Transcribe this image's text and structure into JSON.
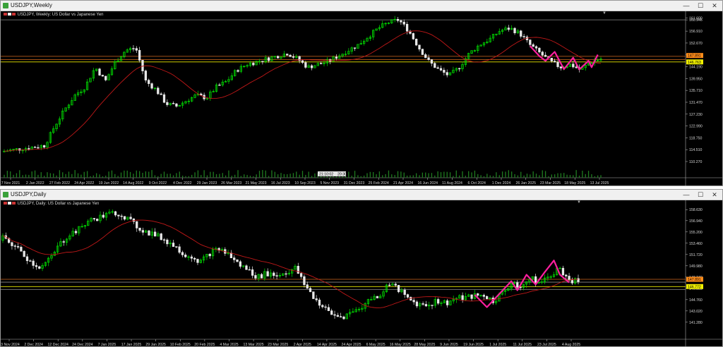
{
  "weekly": {
    "title": "USDJPY,Weekly",
    "info": "USDJPY, Weekly: US Dollar vs Japanese Yen",
    "price_labels": [
      "161.600",
      "160.946",
      "156.910",
      "152.670",
      "148.430",
      "144.190",
      "139.950",
      "135.710",
      "131.470",
      "127.230",
      "122.990",
      "118.750",
      "114.510",
      "110.270"
    ],
    "hl_orange": "147.891",
    "hl_yellow": "146.763",
    "dates": [
      "7 Nov 2021",
      "2 Jan 2022",
      "27 Feb 2022",
      "24 Apr 2022",
      "19 Jun 2022",
      "14 Aug 2022",
      "9 Oct 2022",
      "4 Dec 2022",
      "29 Jan 2023",
      "26 Mar 2023",
      "21 May 2023",
      "16 Jul 2023",
      "10 Sep 2023",
      "5 Nov 2023",
      "31 Dec 2023",
      "25 Feb 2024",
      "21 Apr 2024",
      "16 Jun 2024",
      "11 Aug 2024",
      "6 Oct 2024",
      "1 Dec 2024",
      "26 Jan 2025",
      "23 Mar 2025",
      "18 May 2025",
      "13 Jul 2025"
    ],
    "time_marker": [
      "21:10:02",
      "20:30"
    ]
  },
  "daily": {
    "title": "USDJPY,Daily",
    "info": "USDJPY, Daily: US Dollar vs Japanese Yen",
    "price_labels": [
      "158.630",
      "156.940",
      "155.200",
      "153.460",
      "151.720",
      "149.980",
      "148.240",
      "146.500",
      "144.760",
      "143.020",
      "141.280"
    ],
    "hl_orange": "147.891",
    "hl_yellow": "146.772",
    "dates": [
      "13 Nov 2024",
      "2 Dec 2024",
      "12 Dec 2024",
      "24 Dec 2024",
      "7 Jan 2025",
      "17 Jan 2025",
      "29 Jan 2025",
      "10 Feb 2025",
      "20 Feb 2025",
      "4 Mar 2025",
      "13 Mar 2025",
      "23 Mar 2025",
      "2 Apr 2025",
      "14 Apr 2025",
      "24 Apr 2025",
      "6 May 2025",
      "16 May 2025",
      "28 May 2025",
      "9 Jun 2025",
      "19 Jun 2025",
      "1 Jul 2025",
      "11 Jul 2025",
      "23 Jul 2025",
      "4 Aug 2025"
    ]
  },
  "colors": {
    "bull": "#00e000",
    "bear": "#e8e8e8",
    "ma": "#c01818",
    "zigzag": "#ff1f9f",
    "orange_line": "#d2691e",
    "yellow_line": "#e8e800",
    "grey_line": "#8a8a8a",
    "volume": "#1f7a1f"
  },
  "controls": {
    "minimize": "—",
    "restore": "☐",
    "close": "✕"
  }
}
